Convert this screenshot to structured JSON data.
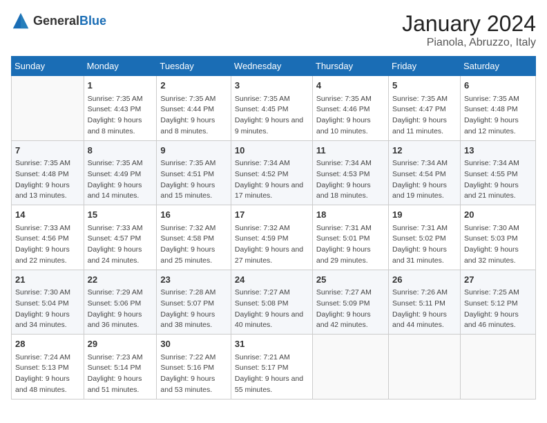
{
  "header": {
    "logo_general": "General",
    "logo_blue": "Blue",
    "month": "January 2024",
    "location": "Pianola, Abruzzo, Italy"
  },
  "weekdays": [
    "Sunday",
    "Monday",
    "Tuesday",
    "Wednesday",
    "Thursday",
    "Friday",
    "Saturday"
  ],
  "weeks": [
    [
      {
        "day": "",
        "sunrise": "",
        "sunset": "",
        "daylight": ""
      },
      {
        "day": "1",
        "sunrise": "Sunrise: 7:35 AM",
        "sunset": "Sunset: 4:43 PM",
        "daylight": "Daylight: 9 hours and 8 minutes."
      },
      {
        "day": "2",
        "sunrise": "Sunrise: 7:35 AM",
        "sunset": "Sunset: 4:44 PM",
        "daylight": "Daylight: 9 hours and 8 minutes."
      },
      {
        "day": "3",
        "sunrise": "Sunrise: 7:35 AM",
        "sunset": "Sunset: 4:45 PM",
        "daylight": "Daylight: 9 hours and 9 minutes."
      },
      {
        "day": "4",
        "sunrise": "Sunrise: 7:35 AM",
        "sunset": "Sunset: 4:46 PM",
        "daylight": "Daylight: 9 hours and 10 minutes."
      },
      {
        "day": "5",
        "sunrise": "Sunrise: 7:35 AM",
        "sunset": "Sunset: 4:47 PM",
        "daylight": "Daylight: 9 hours and 11 minutes."
      },
      {
        "day": "6",
        "sunrise": "Sunrise: 7:35 AM",
        "sunset": "Sunset: 4:48 PM",
        "daylight": "Daylight: 9 hours and 12 minutes."
      }
    ],
    [
      {
        "day": "7",
        "sunrise": "Sunrise: 7:35 AM",
        "sunset": "Sunset: 4:48 PM",
        "daylight": "Daylight: 9 hours and 13 minutes."
      },
      {
        "day": "8",
        "sunrise": "Sunrise: 7:35 AM",
        "sunset": "Sunset: 4:49 PM",
        "daylight": "Daylight: 9 hours and 14 minutes."
      },
      {
        "day": "9",
        "sunrise": "Sunrise: 7:35 AM",
        "sunset": "Sunset: 4:51 PM",
        "daylight": "Daylight: 9 hours and 15 minutes."
      },
      {
        "day": "10",
        "sunrise": "Sunrise: 7:34 AM",
        "sunset": "Sunset: 4:52 PM",
        "daylight": "Daylight: 9 hours and 17 minutes."
      },
      {
        "day": "11",
        "sunrise": "Sunrise: 7:34 AM",
        "sunset": "Sunset: 4:53 PM",
        "daylight": "Daylight: 9 hours and 18 minutes."
      },
      {
        "day": "12",
        "sunrise": "Sunrise: 7:34 AM",
        "sunset": "Sunset: 4:54 PM",
        "daylight": "Daylight: 9 hours and 19 minutes."
      },
      {
        "day": "13",
        "sunrise": "Sunrise: 7:34 AM",
        "sunset": "Sunset: 4:55 PM",
        "daylight": "Daylight: 9 hours and 21 minutes."
      }
    ],
    [
      {
        "day": "14",
        "sunrise": "Sunrise: 7:33 AM",
        "sunset": "Sunset: 4:56 PM",
        "daylight": "Daylight: 9 hours and 22 minutes."
      },
      {
        "day": "15",
        "sunrise": "Sunrise: 7:33 AM",
        "sunset": "Sunset: 4:57 PM",
        "daylight": "Daylight: 9 hours and 24 minutes."
      },
      {
        "day": "16",
        "sunrise": "Sunrise: 7:32 AM",
        "sunset": "Sunset: 4:58 PM",
        "daylight": "Daylight: 9 hours and 25 minutes."
      },
      {
        "day": "17",
        "sunrise": "Sunrise: 7:32 AM",
        "sunset": "Sunset: 4:59 PM",
        "daylight": "Daylight: 9 hours and 27 minutes."
      },
      {
        "day": "18",
        "sunrise": "Sunrise: 7:31 AM",
        "sunset": "Sunset: 5:01 PM",
        "daylight": "Daylight: 9 hours and 29 minutes."
      },
      {
        "day": "19",
        "sunrise": "Sunrise: 7:31 AM",
        "sunset": "Sunset: 5:02 PM",
        "daylight": "Daylight: 9 hours and 31 minutes."
      },
      {
        "day": "20",
        "sunrise": "Sunrise: 7:30 AM",
        "sunset": "Sunset: 5:03 PM",
        "daylight": "Daylight: 9 hours and 32 minutes."
      }
    ],
    [
      {
        "day": "21",
        "sunrise": "Sunrise: 7:30 AM",
        "sunset": "Sunset: 5:04 PM",
        "daylight": "Daylight: 9 hours and 34 minutes."
      },
      {
        "day": "22",
        "sunrise": "Sunrise: 7:29 AM",
        "sunset": "Sunset: 5:06 PM",
        "daylight": "Daylight: 9 hours and 36 minutes."
      },
      {
        "day": "23",
        "sunrise": "Sunrise: 7:28 AM",
        "sunset": "Sunset: 5:07 PM",
        "daylight": "Daylight: 9 hours and 38 minutes."
      },
      {
        "day": "24",
        "sunrise": "Sunrise: 7:27 AM",
        "sunset": "Sunset: 5:08 PM",
        "daylight": "Daylight: 9 hours and 40 minutes."
      },
      {
        "day": "25",
        "sunrise": "Sunrise: 7:27 AM",
        "sunset": "Sunset: 5:09 PM",
        "daylight": "Daylight: 9 hours and 42 minutes."
      },
      {
        "day": "26",
        "sunrise": "Sunrise: 7:26 AM",
        "sunset": "Sunset: 5:11 PM",
        "daylight": "Daylight: 9 hours and 44 minutes."
      },
      {
        "day": "27",
        "sunrise": "Sunrise: 7:25 AM",
        "sunset": "Sunset: 5:12 PM",
        "daylight": "Daylight: 9 hours and 46 minutes."
      }
    ],
    [
      {
        "day": "28",
        "sunrise": "Sunrise: 7:24 AM",
        "sunset": "Sunset: 5:13 PM",
        "daylight": "Daylight: 9 hours and 48 minutes."
      },
      {
        "day": "29",
        "sunrise": "Sunrise: 7:23 AM",
        "sunset": "Sunset: 5:14 PM",
        "daylight": "Daylight: 9 hours and 51 minutes."
      },
      {
        "day": "30",
        "sunrise": "Sunrise: 7:22 AM",
        "sunset": "Sunset: 5:16 PM",
        "daylight": "Daylight: 9 hours and 53 minutes."
      },
      {
        "day": "31",
        "sunrise": "Sunrise: 7:21 AM",
        "sunset": "Sunset: 5:17 PM",
        "daylight": "Daylight: 9 hours and 55 minutes."
      },
      {
        "day": "",
        "sunrise": "",
        "sunset": "",
        "daylight": ""
      },
      {
        "day": "",
        "sunrise": "",
        "sunset": "",
        "daylight": ""
      },
      {
        "day": "",
        "sunrise": "",
        "sunset": "",
        "daylight": ""
      }
    ]
  ]
}
